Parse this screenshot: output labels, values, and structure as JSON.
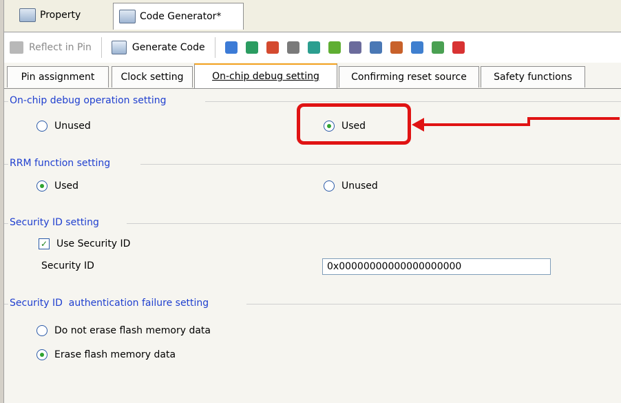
{
  "doc_tabs": [
    "Property",
    "Code Generator*"
  ],
  "toolbar": {
    "reflect_label": "Reflect in Pin",
    "generate_label": "Generate Code"
  },
  "tabs": [
    "Pin assignment",
    "Clock setting",
    "On-chip debug setting",
    "Confirming reset source",
    "Safety functions"
  ],
  "groups": {
    "onchip": {
      "title": "On-chip debug operation setting",
      "opt_unused": "Unused",
      "opt_used": "Used",
      "selected": "Used"
    },
    "rrm": {
      "title": "RRM function setting",
      "opt_used": "Used",
      "opt_unused": "Unused",
      "selected": "Used"
    },
    "security": {
      "title": "Security ID setting",
      "use_label": "Use Security ID",
      "id_label": "Security ID",
      "id_value": "0x00000000000000000000"
    },
    "auth_fail": {
      "title": "Security ID  authentication failure setting",
      "opt_noerase": "Do not erase flash memory data",
      "opt_erase": "Erase flash memory data",
      "selected": "Erase flash memory data"
    }
  },
  "colors": {
    "annotation": "#e01313",
    "group_title": "#1f3fcf",
    "active_tab_accent": "#f3a11e"
  }
}
